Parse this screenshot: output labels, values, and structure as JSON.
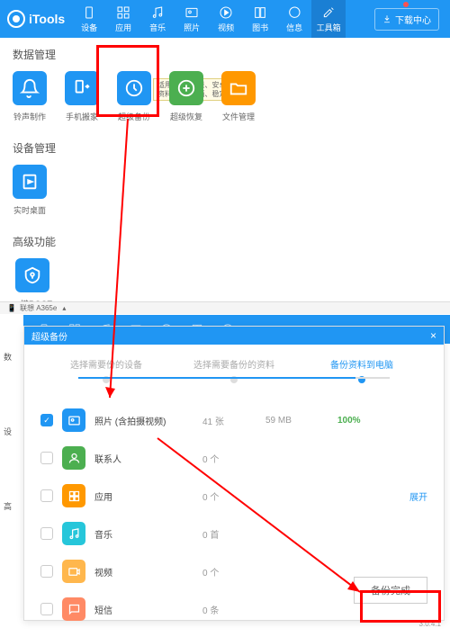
{
  "app": {
    "name": "iTools"
  },
  "nav": [
    {
      "label": "设备"
    },
    {
      "label": "应用"
    },
    {
      "label": "音乐"
    },
    {
      "label": "照片"
    },
    {
      "label": "视频"
    },
    {
      "label": "图书"
    },
    {
      "label": "信息"
    },
    {
      "label": "工具箱"
    }
  ],
  "download_btn": "下载中心",
  "sections": {
    "data_mgmt": {
      "title": "数据管理",
      "items": [
        {
          "label": "铃声制作"
        },
        {
          "label": "手机搬家"
        },
        {
          "label": "超级备份"
        },
        {
          "label": "超级恢复"
        },
        {
          "label": "文件管理"
        }
      ]
    },
    "device_mgmt": {
      "title": "设备管理",
      "items": [
        {
          "label": "实时桌面"
        }
      ]
    },
    "advanced": {
      "title": "高级功能",
      "items": [
        {
          "label": "一键ROOT"
        }
      ]
    }
  },
  "tooltip": {
    "line1": "适用平台: 苹果、安卓",
    "line2": "资料备份: 全面、稳定、精准"
  },
  "device_bar": "联想 A365e",
  "dialog": {
    "title": "超级备份",
    "steps": [
      "选择需要份的设备",
      "选择需要备份的资料",
      "备份资料到电脑"
    ],
    "items": [
      {
        "name": "照片 (含拍摄视频)",
        "count": "41 张",
        "size": "59 MB",
        "pct": "100%",
        "checked": true,
        "color": "#2096f3"
      },
      {
        "name": "联系人",
        "count": "0 个",
        "size": "",
        "color": "#4caf50"
      },
      {
        "name": "应用",
        "count": "0 个",
        "size": "",
        "link": "展开",
        "color": "#ff9800"
      },
      {
        "name": "音乐",
        "count": "0 首",
        "size": "",
        "color": "#26c6da"
      },
      {
        "name": "视频",
        "count": "0 个",
        "size": "",
        "color": "#ffb74d"
      },
      {
        "name": "短信",
        "count": "0 条",
        "size": "",
        "color": "#ff8a65"
      }
    ],
    "done": "备份完成"
  },
  "version": "3.0.4.1"
}
